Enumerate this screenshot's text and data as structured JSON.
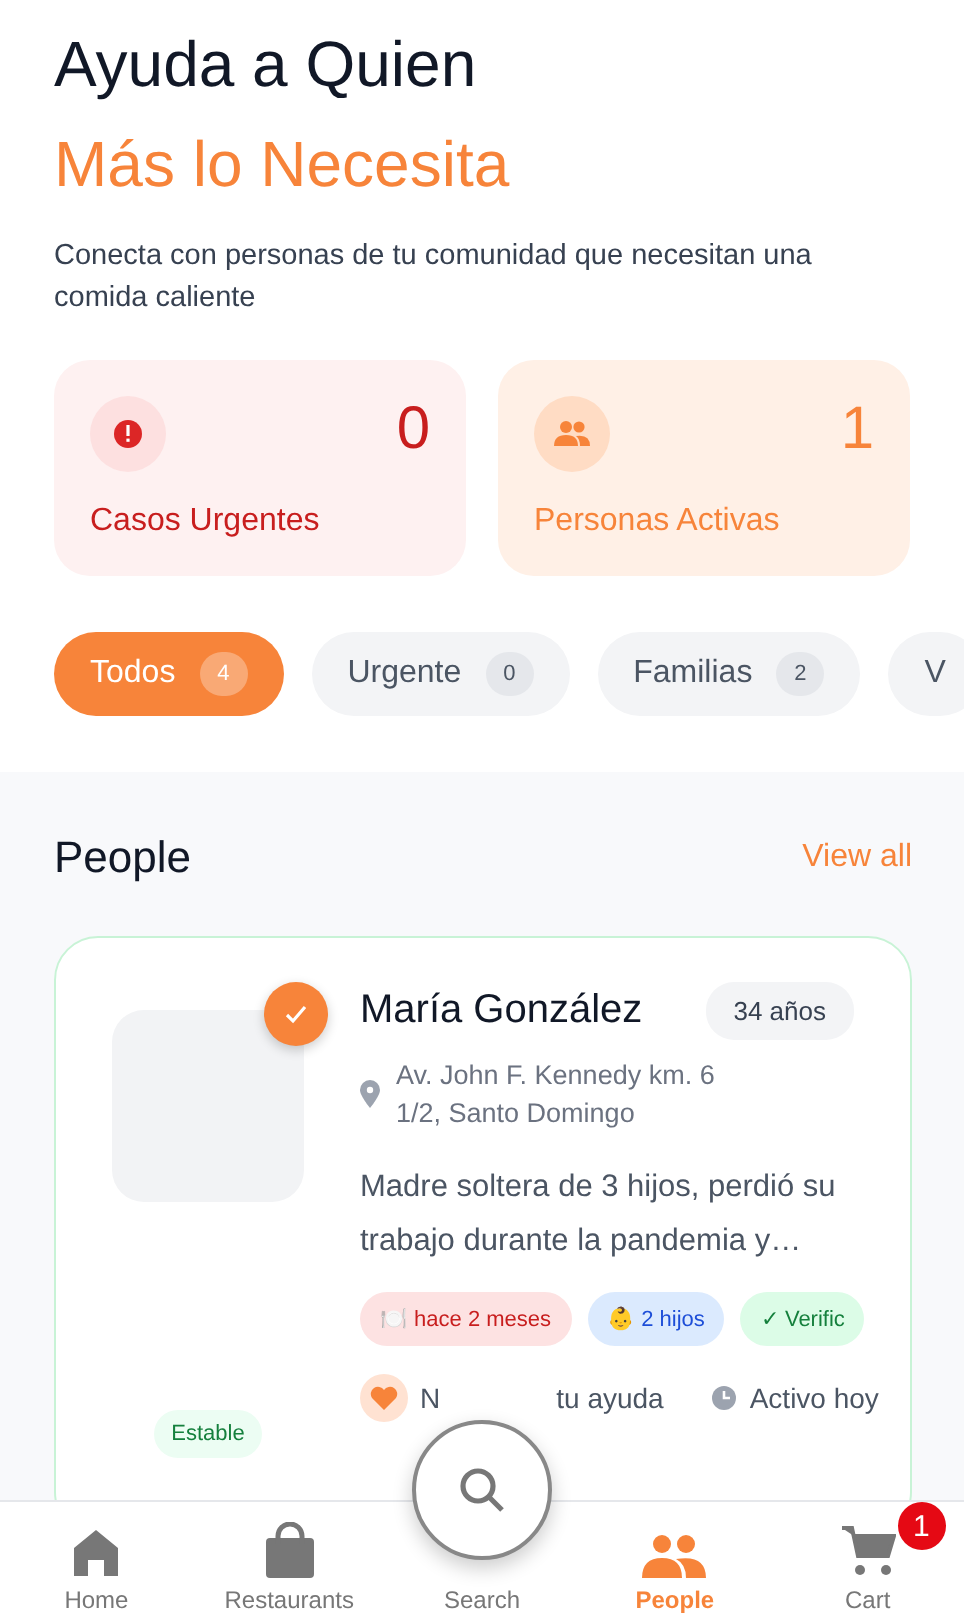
{
  "header": {
    "title": "Ayuda a Quien",
    "highlight": "Más lo Necesita",
    "description": "Conecta con personas de tu comunidad que necesitan una comida caliente"
  },
  "stats": [
    {
      "kind": "urgent",
      "value": "0",
      "label": "Casos Urgentes"
    },
    {
      "kind": "active",
      "value": "1",
      "label": "Personas Activas"
    }
  ],
  "filters": [
    {
      "label": "Todos",
      "count": "4",
      "selected": true
    },
    {
      "label": "Urgente",
      "count": "0",
      "selected": false
    },
    {
      "label": "Familias",
      "count": "2",
      "selected": false
    },
    {
      "label": "V",
      "selected": false
    }
  ],
  "section": {
    "title": "People",
    "link": "View all"
  },
  "person": {
    "name": "María González",
    "age": "34 años",
    "verified": true,
    "address": "Av. John F. Kennedy km. 6 1/2, Santo Domingo",
    "story": "Madre soltera de 3 hijos, perdió su trabajo durante la pandemia y…",
    "status": "Estable",
    "tags": [
      {
        "kind": "meal",
        "icon": "🍽️",
        "text": "hace 2 meses"
      },
      {
        "kind": "kids",
        "icon": "👶",
        "text": "2 hijos"
      },
      {
        "kind": "verified",
        "icon": "✓",
        "text": "Verific"
      }
    ],
    "need_start": "N",
    "need_end": "tu ayuda",
    "activity": "Activo hoy"
  },
  "nav": [
    {
      "kind": "home",
      "label": "Home",
      "selected": false
    },
    {
      "kind": "restaurants",
      "label": "Restaurants",
      "selected": false
    },
    {
      "kind": "search",
      "label": "Search",
      "selected": false
    },
    {
      "kind": "people",
      "label": "People",
      "selected": true
    },
    {
      "kind": "cart",
      "label": "Cart",
      "selected": false,
      "badge": "1"
    }
  ]
}
